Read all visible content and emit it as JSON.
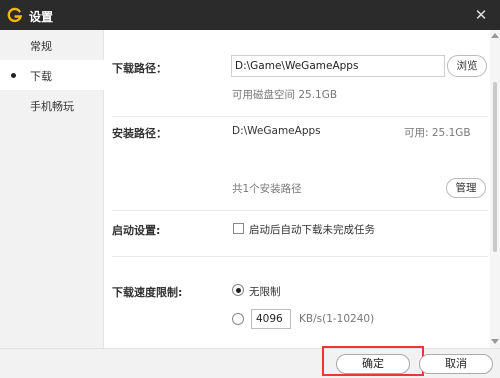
{
  "window": {
    "title": "设置",
    "logo_icon": "wegame-g-logo",
    "accent_color": "#f5b800"
  },
  "sidebar": {
    "items": [
      {
        "label": "常规",
        "active": false
      },
      {
        "label": "下载",
        "active": true
      },
      {
        "label": "手机畅玩",
        "active": false
      }
    ]
  },
  "download_path": {
    "label": "下载路径：",
    "value": "D:\\Game\\WeGameApps",
    "browse_label": "浏览",
    "free_space": "可用磁盘空间 25.1GB"
  },
  "install_path": {
    "label": "安装路径：",
    "path": "D:\\WeGameApps",
    "available": "可用: 25.1GB",
    "count_text": "共1个安装路径",
    "manage_label": "管理"
  },
  "startup": {
    "label": "启动设置:",
    "option_label": "启动后自动下载未完成任务",
    "checked": false
  },
  "speed_limit": {
    "label": "下载速度限制:",
    "unlimited_label": "无限制",
    "limit_value": "4096",
    "unit_label": "KB/s(1-10240)",
    "selected": "unlimited"
  },
  "footer": {
    "confirm_label": "确定",
    "cancel_label": "取消"
  }
}
